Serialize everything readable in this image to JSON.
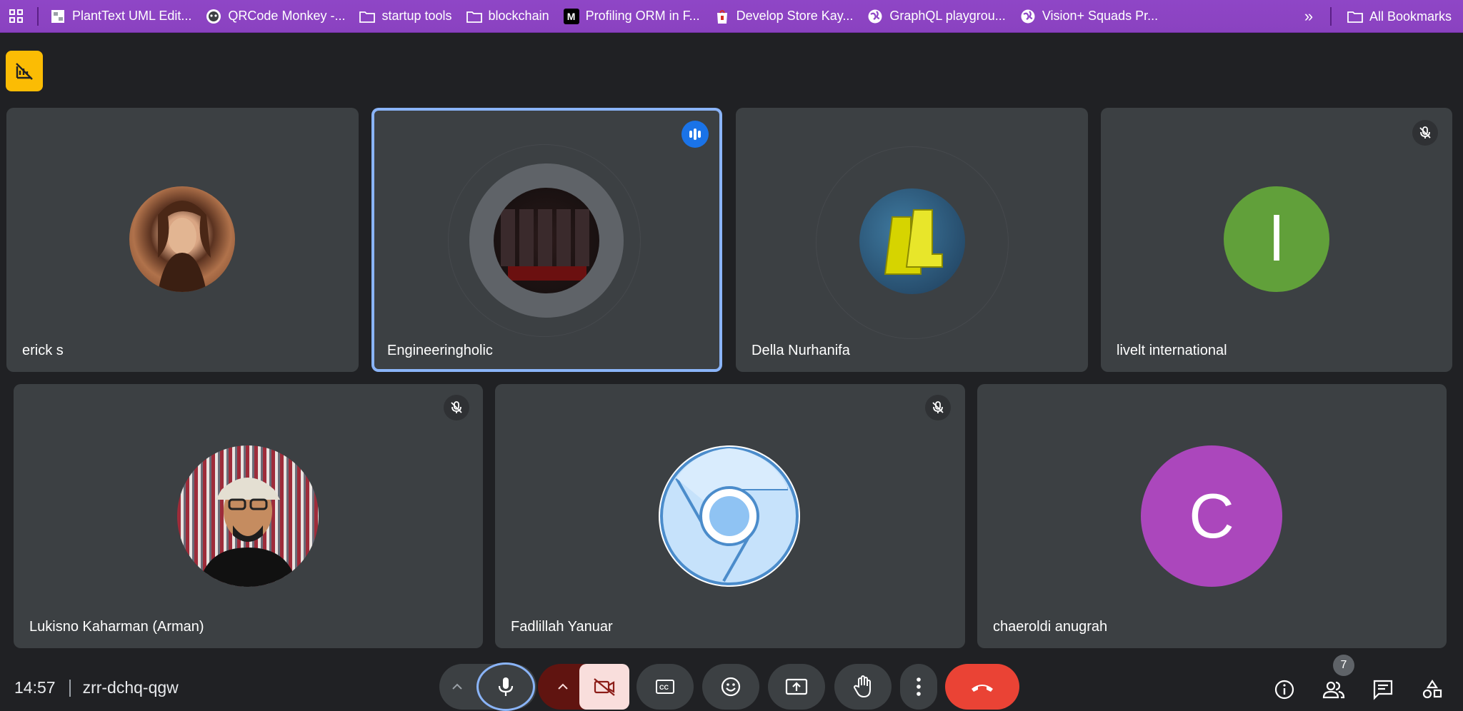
{
  "bookmarks": {
    "items": [
      {
        "label": "PlantText UML Edit...",
        "icon": "planttext-favicon"
      },
      {
        "label": "QRCode Monkey -...",
        "icon": "qrcode-monkey-favicon"
      },
      {
        "label": "startup tools",
        "icon": "folder-icon"
      },
      {
        "label": "blockchain",
        "icon": "folder-icon"
      },
      {
        "label": "Profiling ORM in F...",
        "icon": "medium-favicon",
        "fav_text": "M"
      },
      {
        "label": "Develop Store Kay...",
        "icon": "store-favicon"
      },
      {
        "label": "GraphQL playgrou...",
        "icon": "globe-icon"
      },
      {
        "label": "Vision+ Squads Pr...",
        "icon": "globe-icon"
      }
    ],
    "more": "»",
    "all_bookmarks": "All Bookmarks"
  },
  "tiles": [
    {
      "name": "erick s",
      "avatar": "photo-long-hair",
      "muted": false,
      "speaking": false
    },
    {
      "name": "Engineeringholic",
      "avatar": "photo-shelves",
      "muted": false,
      "speaking": true
    },
    {
      "name": "Della Nurhanifa",
      "avatar": "photo-yellow-boots",
      "muted": false,
      "speaking": false
    },
    {
      "name": "livelt international",
      "avatar": "initial",
      "initial": "l",
      "muted": true,
      "speaking": false
    },
    {
      "name": "Lukisno Kaharman (Arman)",
      "avatar": "photo-man-bucket-hat",
      "muted": true,
      "speaking": false
    },
    {
      "name": "Fadlillah Yanuar",
      "avatar": "chrome-logo",
      "muted": true,
      "speaking": false
    },
    {
      "name": "chaeroldi anugrah",
      "avatar": "initial",
      "initial": "C",
      "muted": false,
      "speaking": false
    }
  ],
  "meeting": {
    "time": "14:57",
    "code": "zrr-dchq-qgw",
    "participant_count": "7"
  },
  "colors": {
    "bookmark_bar": "#8f46c6",
    "background": "#202124",
    "tile": "#3c4043",
    "speaking_border": "#8ab4f8",
    "livelt_avatar": "#61a03a",
    "chaeroldi_avatar": "#ab47bc",
    "end_call": "#ea4335",
    "camera_off": "#f9dedc",
    "warning_badge": "#fbbc04"
  },
  "controls": [
    "mic-options",
    "mic",
    "camera-options",
    "camera",
    "captions",
    "reactions",
    "present",
    "raise-hand",
    "more-options",
    "end-call"
  ],
  "right_controls": [
    "meeting-details",
    "people",
    "chat",
    "activities"
  ]
}
